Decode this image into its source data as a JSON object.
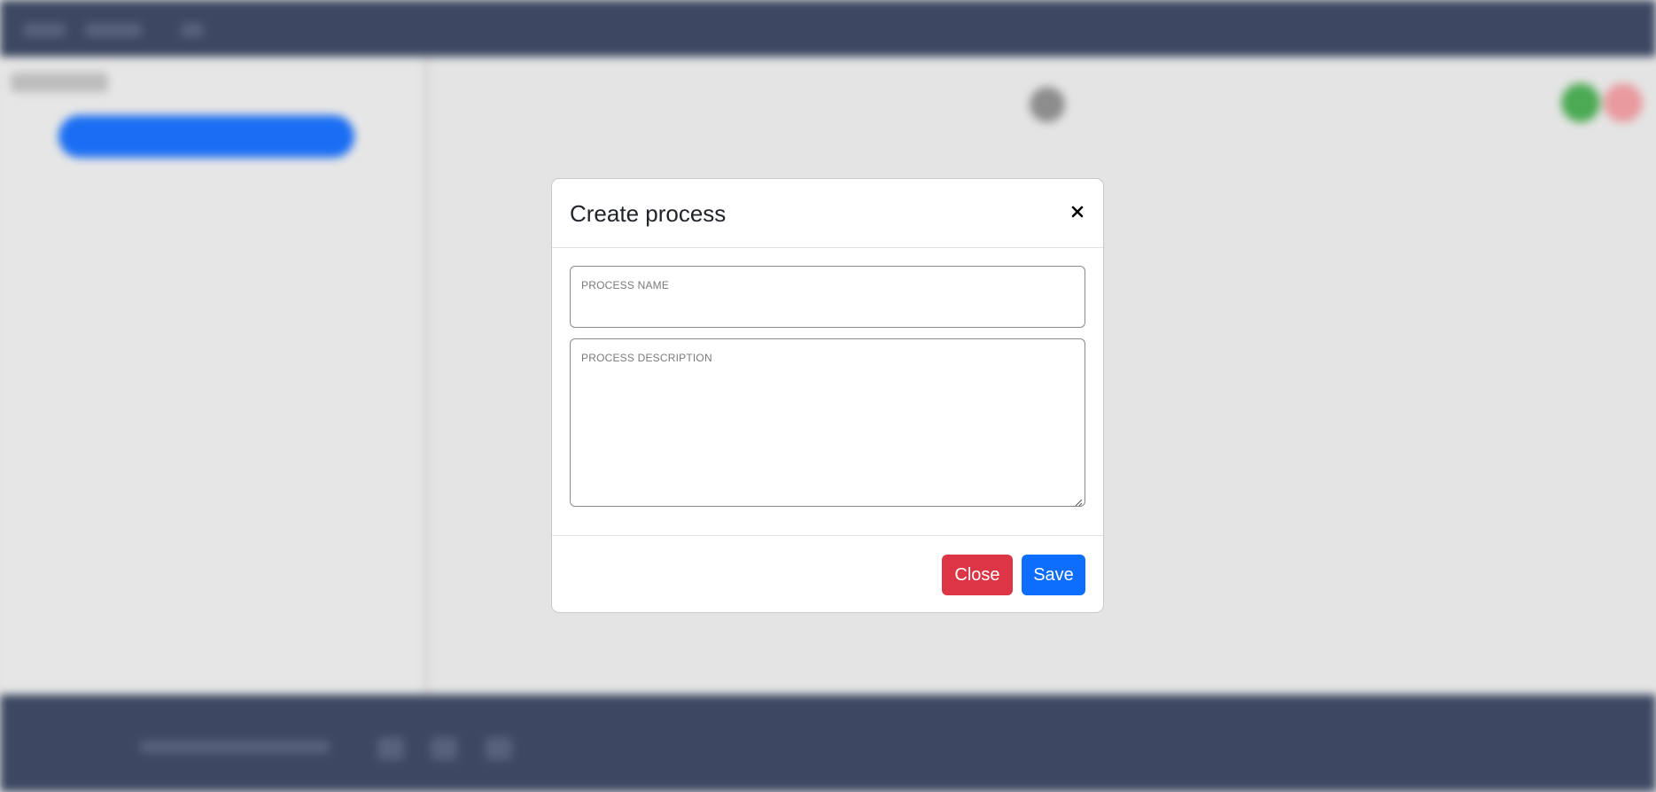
{
  "modal": {
    "title": "Create process",
    "close_icon": "close-icon",
    "fields": {
      "name": {
        "label": "PROCESS NAME",
        "value": ""
      },
      "description": {
        "label": "PROCESS DESCRIPTION",
        "value": ""
      }
    },
    "buttons": {
      "close_label": "Close",
      "save_label": "Save"
    }
  },
  "colors": {
    "header_bg": "#3c4862",
    "primary": "#0d6efd",
    "danger": "#dc3545",
    "success": "#4caa52"
  }
}
